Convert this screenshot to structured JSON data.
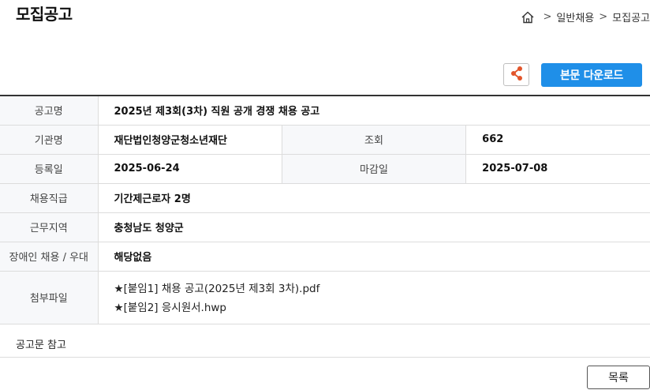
{
  "header": {
    "title": "모집공고",
    "breadcrumb": [
      "일반채용",
      "모집공고"
    ],
    "separator": ">"
  },
  "actions": {
    "share_icon": "share-icon",
    "download_label": "본문 다운로드",
    "accent_color": "#1f8fe8"
  },
  "table": {
    "title_label": "공고명",
    "title_value": "2025년 제3회(3차) 직원 공개 경쟁 채용 공고",
    "org_label": "기관명",
    "org_value": "재단법인청양군청소년재단",
    "views_label": "조회",
    "views_value": "662",
    "reg_label": "등록일",
    "reg_value": "2025-06-24",
    "deadline_label": "마감일",
    "deadline_value": "2025-07-08",
    "position_label": "채용직급",
    "position_value": "기간제근로자 2명",
    "region_label": "근무지역",
    "region_value": "충청남도 청양군",
    "disability_label": "장애인 채용 / 우대",
    "disability_value": "해당없음",
    "attach_label": "첨부파일",
    "attachments": [
      "★[붙임1] 채용 공고(2025년 제3회 3차).pdf",
      "★[붙임2] 응시원서.hwp"
    ]
  },
  "notice_text": "공고문 참고",
  "list_button": "목록"
}
